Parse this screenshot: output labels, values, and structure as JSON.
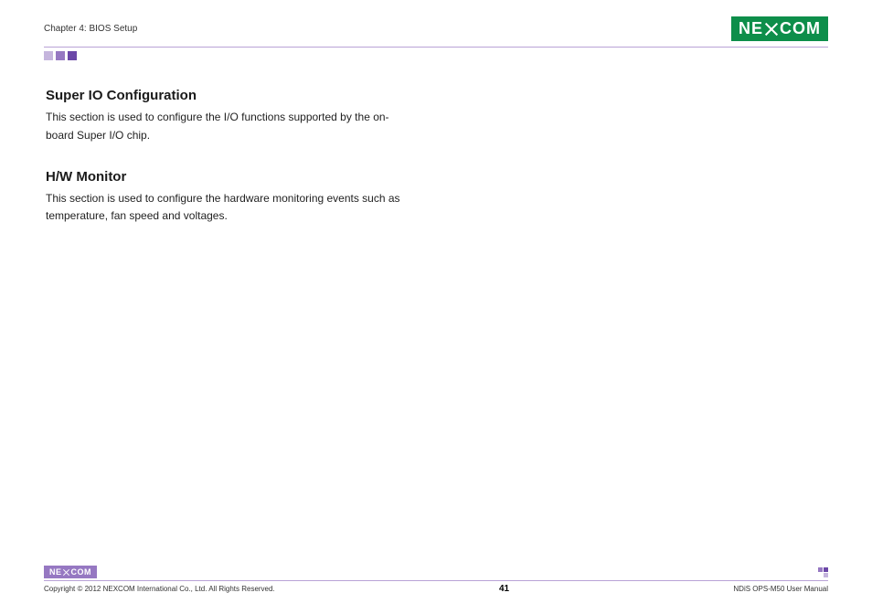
{
  "header": {
    "chapter_title": "Chapter 4: BIOS Setup",
    "logo_text_left": "NE",
    "logo_text_right": "COM"
  },
  "sections": {
    "super_io": {
      "heading": "Super IO Configuration",
      "text": "This section is used to configure the I/O functions supported by the on-board Super I/O chip."
    },
    "hw_monitor": {
      "heading": "H/W Monitor",
      "text": "This section is used to configure the hardware monitoring events such as temperature, fan speed and voltages."
    }
  },
  "footer": {
    "logo_text_left": "NE",
    "logo_text_right": "COM",
    "copyright": "Copyright © 2012 NEXCOM International Co., Ltd. All Rights Reserved.",
    "page_number": "41",
    "manual_name": "NDiS OPS-M50 User Manual"
  }
}
